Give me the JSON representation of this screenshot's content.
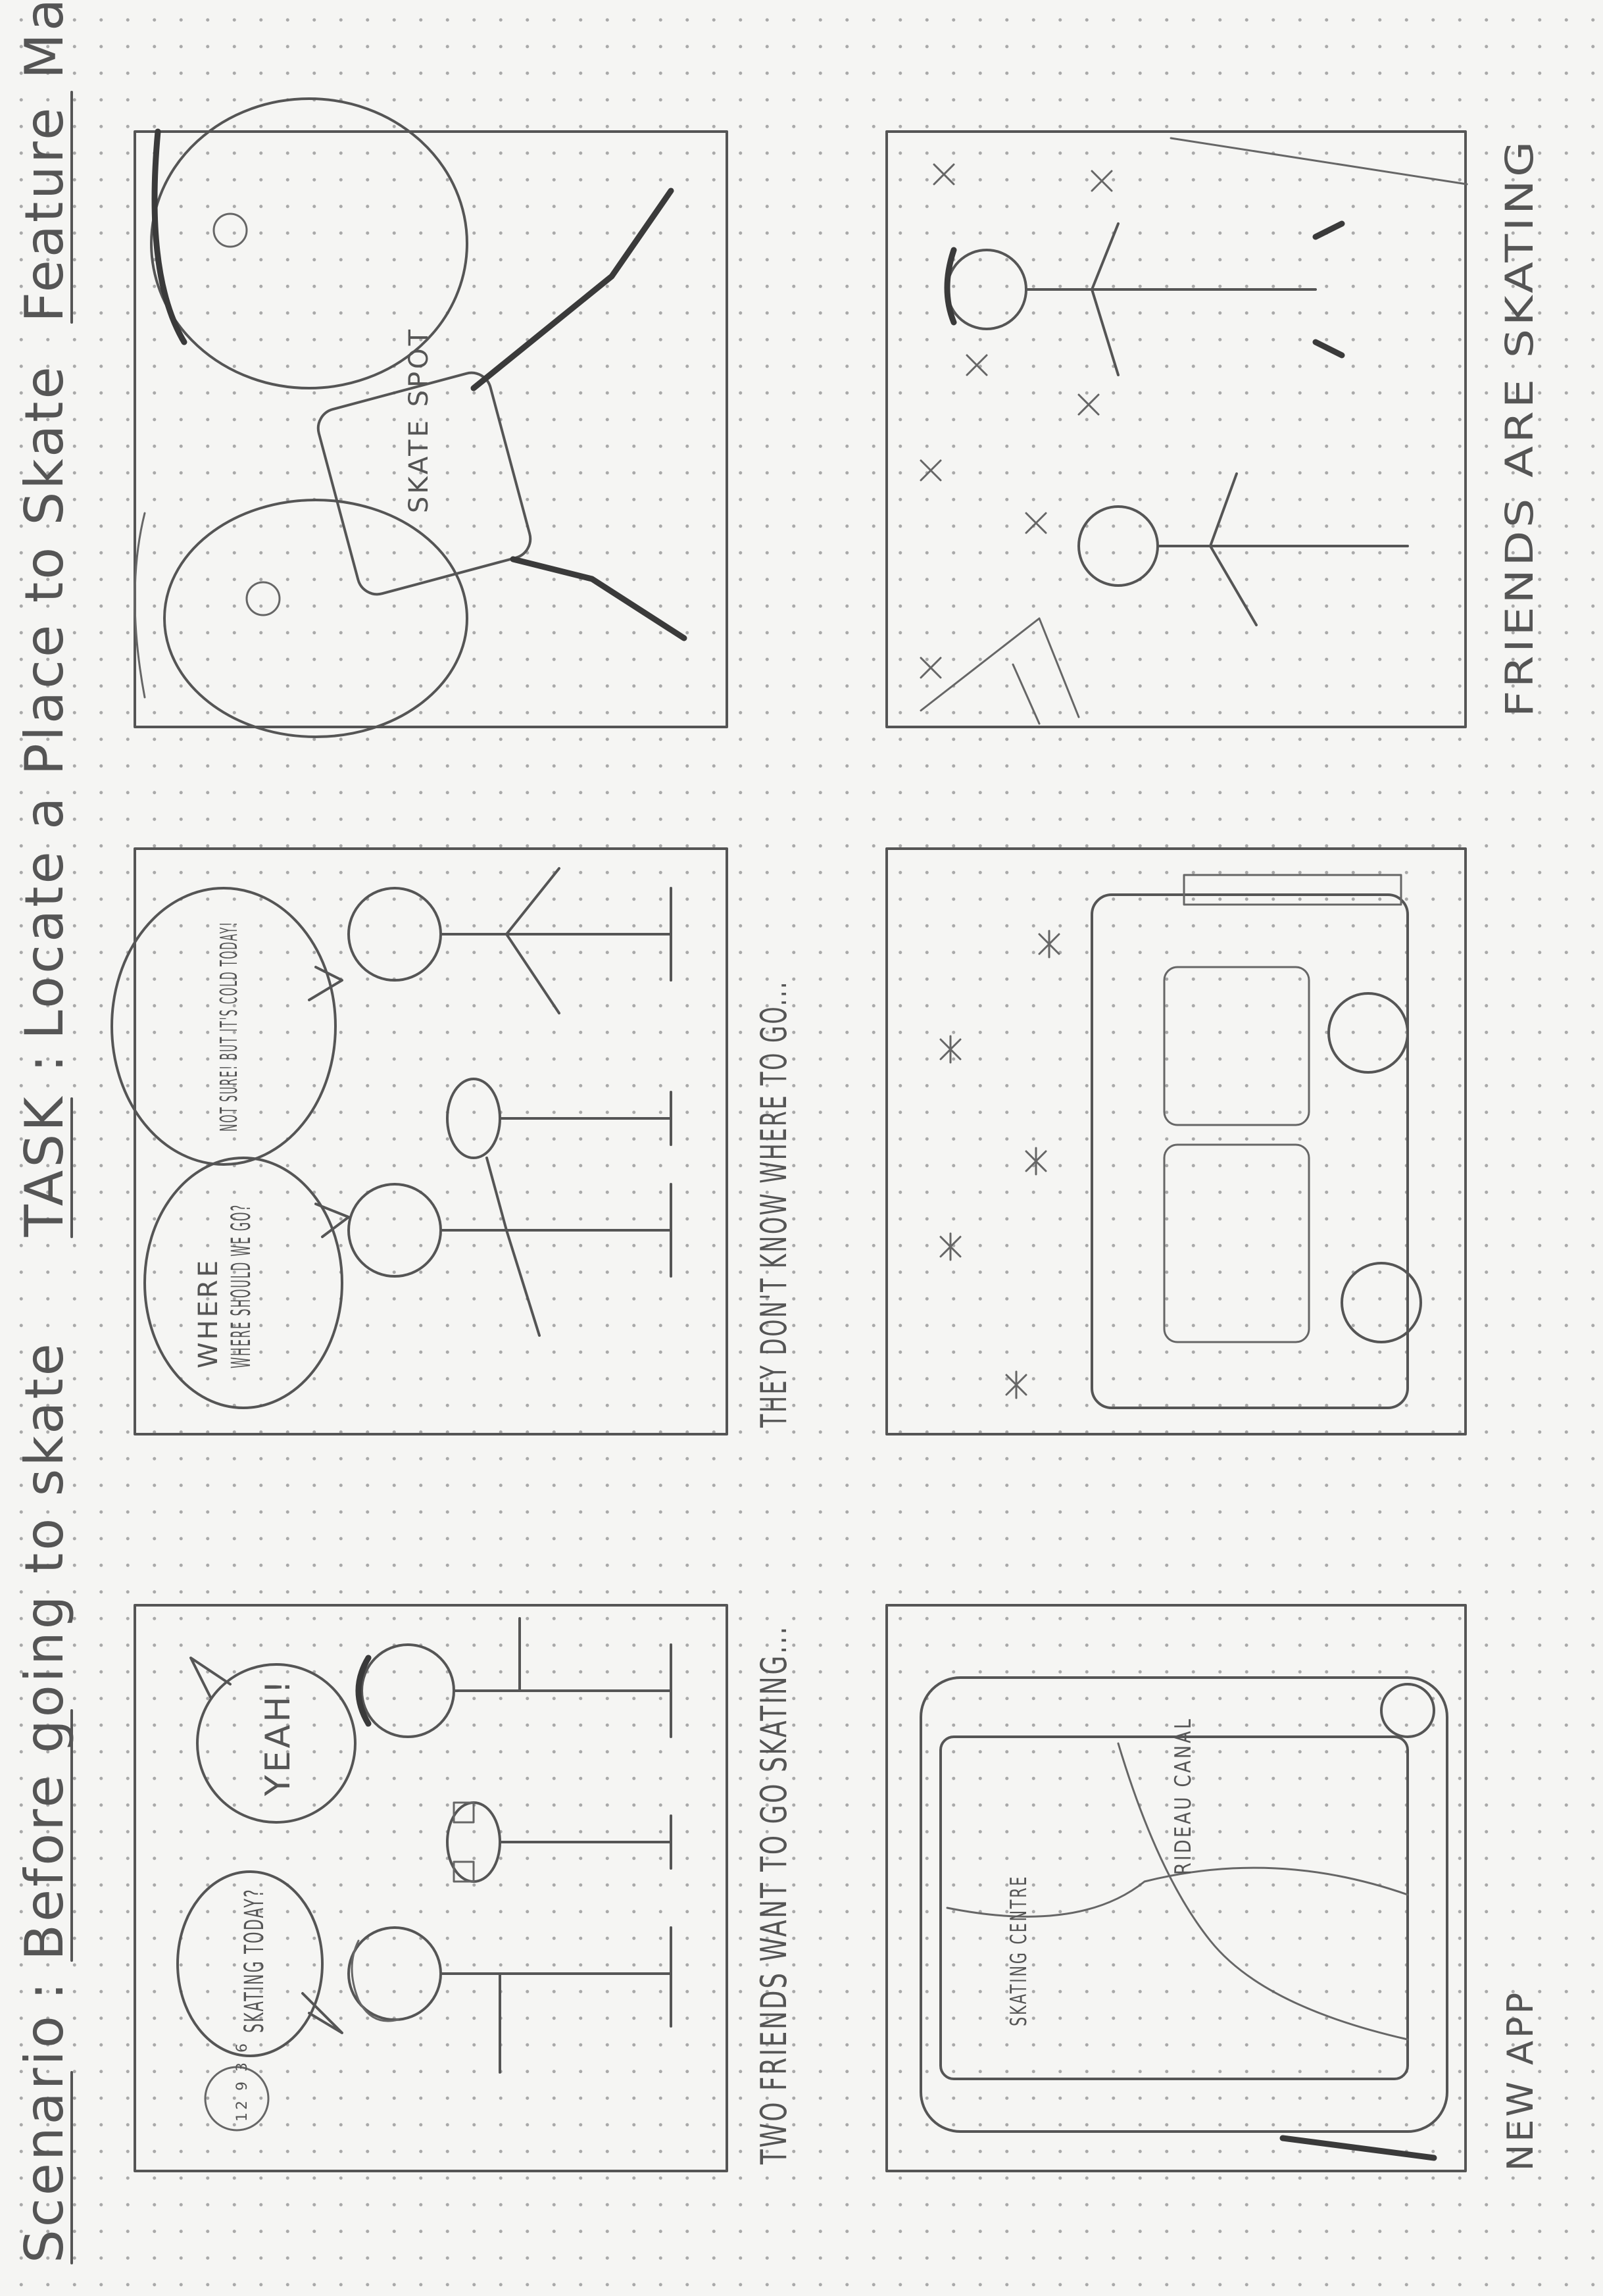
{
  "title": {
    "scenario_label": "Scenario",
    "scenario_value": "Before going to skate",
    "task_label": "TASK",
    "task_value": "Locate a Place to Skate",
    "feature_label": "Feature",
    "feature_value": "Map"
  },
  "panels": [
    {
      "caption": "TWO FRIENDS WANT TO GO SKATING...",
      "bubbles": [
        "SKATING TODAY?",
        "YEAH!"
      ],
      "clock": "12 9 3 6"
    },
    {
      "caption": "THEY DON'T KNOW WHERE TO GO...",
      "bubbles": [
        "WHERE SHOULD WE GO?",
        "NOT SURE! BUT IT'S COLD TODAY!"
      ]
    },
    {
      "caption": "",
      "phone_text": "SKATE SPOT"
    },
    {
      "caption": "NEW APP",
      "map_labels": [
        "SKATING CENTRE",
        "RIDEAU CANAL"
      ]
    },
    {
      "caption": ""
    },
    {
      "caption": "FRIENDS ARE SKATING"
    }
  ],
  "colors": {
    "paper": "#f5f5f3",
    "pencil": "#555555",
    "dots": "#a9a9a9"
  }
}
